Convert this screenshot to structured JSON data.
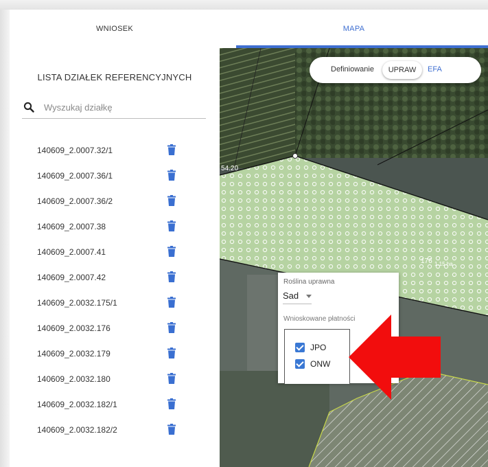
{
  "tabs": {
    "wniosek": "WNIOSEK",
    "mapa": "MAPA"
  },
  "sidebar": {
    "title": "LISTA DZIAŁEK REFERENCYJNYCH",
    "search_placeholder": "Wyszukaj działkę",
    "parcels": [
      "140609_2.0007.32/1",
      "140609_2.0007.36/1",
      "140609_2.0007.36/2",
      "140609_2.0007.38",
      "140609_2.0007.41",
      "140609_2.0007.42",
      "140609_2.0032.175/1",
      "140609_2.0032.176",
      "140609_2.0032.179",
      "140609_2.0032.180",
      "140609_2.0032.182/1",
      "140609_2.0032.182/2"
    ]
  },
  "toggle": {
    "prefix": "Definiowanie",
    "upraw": "UPRAW",
    "efa": "EFA"
  },
  "map": {
    "label_left": "54.20",
    "label_176": "176",
    "label_area": "1.15 ha",
    "label_fragment": "olo"
  },
  "popup": {
    "crop_label": "Roślina uprawna",
    "crop_value": "Sad",
    "payments_label": "Wnioskowane płatności",
    "payments": [
      {
        "label": "JPO",
        "checked": true
      },
      {
        "label": "ONW",
        "checked": true
      }
    ]
  },
  "colors": {
    "accent": "#3f6fd1",
    "trash": "#3a6fd1",
    "arrow": "#f20d0d",
    "parcel_fill": "#c7e6b0"
  }
}
